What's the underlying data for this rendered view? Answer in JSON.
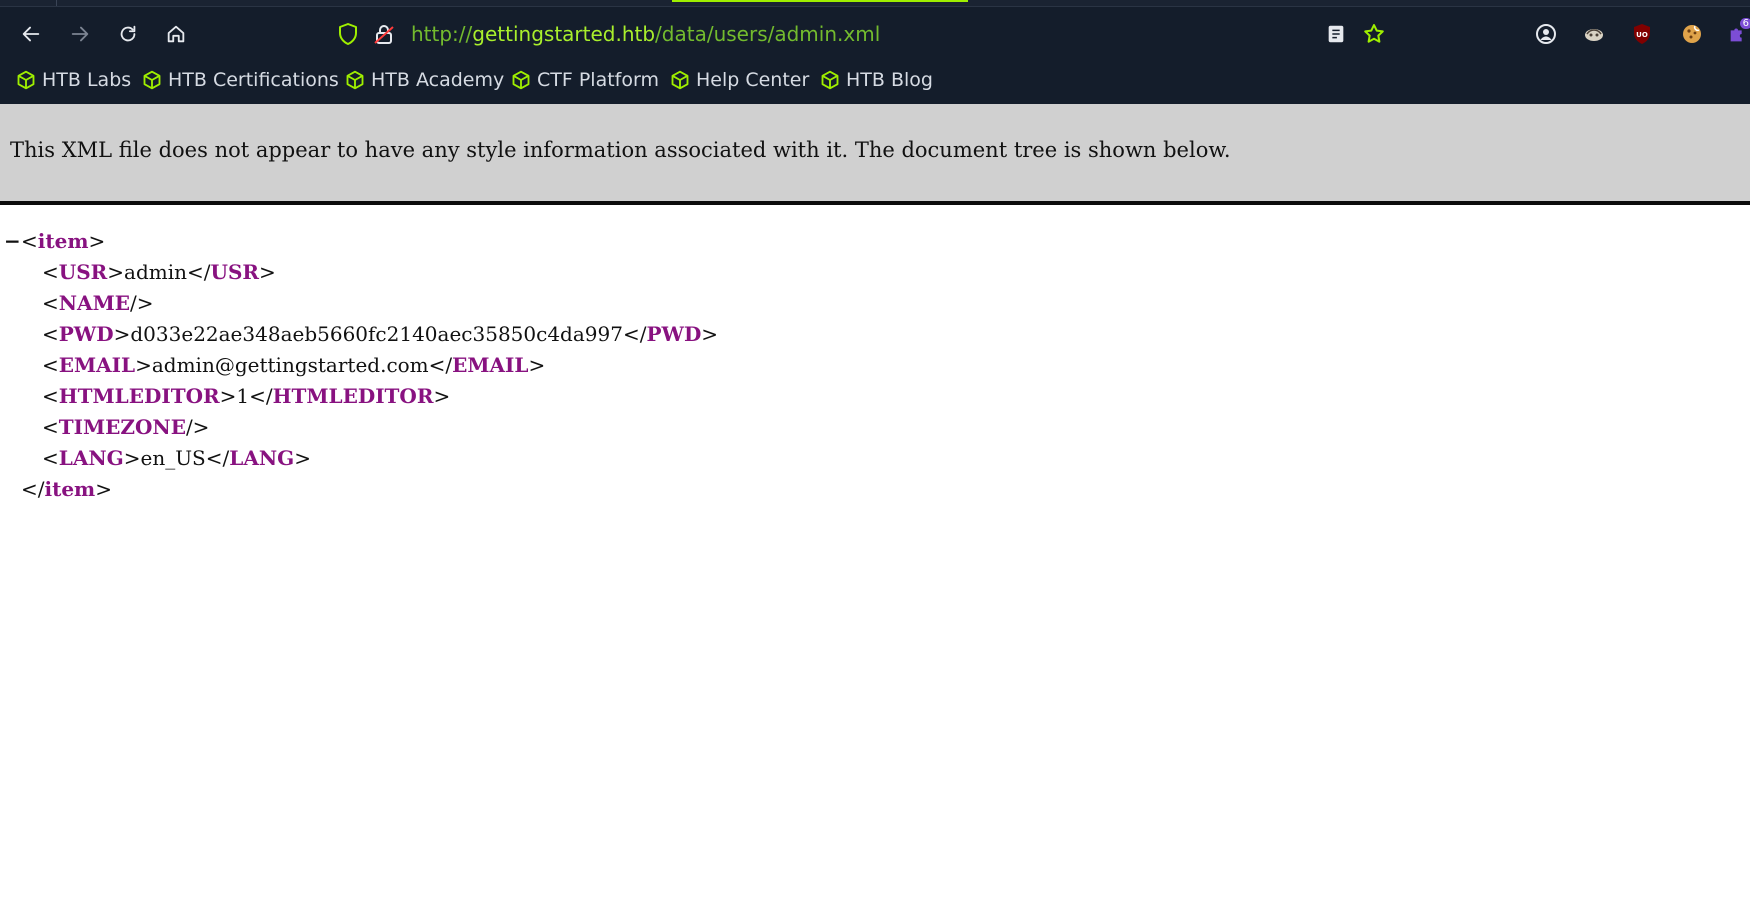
{
  "browser": {
    "url_prefix": "http://",
    "url_host": "gettingstarted.htb",
    "url_path": "/data/users/admin.xml",
    "accent_color": "#9fef00",
    "extension_badge": "6",
    "icons": [
      "back-icon",
      "forward-icon",
      "reload-icon",
      "home-icon",
      "shield-icon",
      "insecure-lock-icon",
      "reader-view-icon",
      "bookmark-star-icon",
      "account-icon",
      "extension-icon",
      "ublock-icon",
      "cookie-icon",
      "extensions-puzzle-icon"
    ]
  },
  "bookmarks": [
    {
      "label": "HTB Labs"
    },
    {
      "label": "HTB Certifications"
    },
    {
      "label": "HTB Academy"
    },
    {
      "label": "CTF Platform"
    },
    {
      "label": "Help Center"
    },
    {
      "label": "HTB Blog"
    }
  ],
  "banner": {
    "text": "This XML file does not appear to have any style information associated with it. The document tree is shown below."
  },
  "xml": {
    "collapse_symbol": "−",
    "root_tag": "item",
    "children": [
      {
        "tag": "USR",
        "value": "admin"
      },
      {
        "tag": "NAME",
        "value": ""
      },
      {
        "tag": "PWD",
        "value": "d033e22ae348aeb5660fc2140aec35850c4da997"
      },
      {
        "tag": "EMAIL",
        "value": "admin@gettingstarted.com"
      },
      {
        "tag": "HTMLEDITOR",
        "value": "1"
      },
      {
        "tag": "TIMEZONE",
        "value": ""
      },
      {
        "tag": "LANG",
        "value": "en_US"
      }
    ]
  }
}
